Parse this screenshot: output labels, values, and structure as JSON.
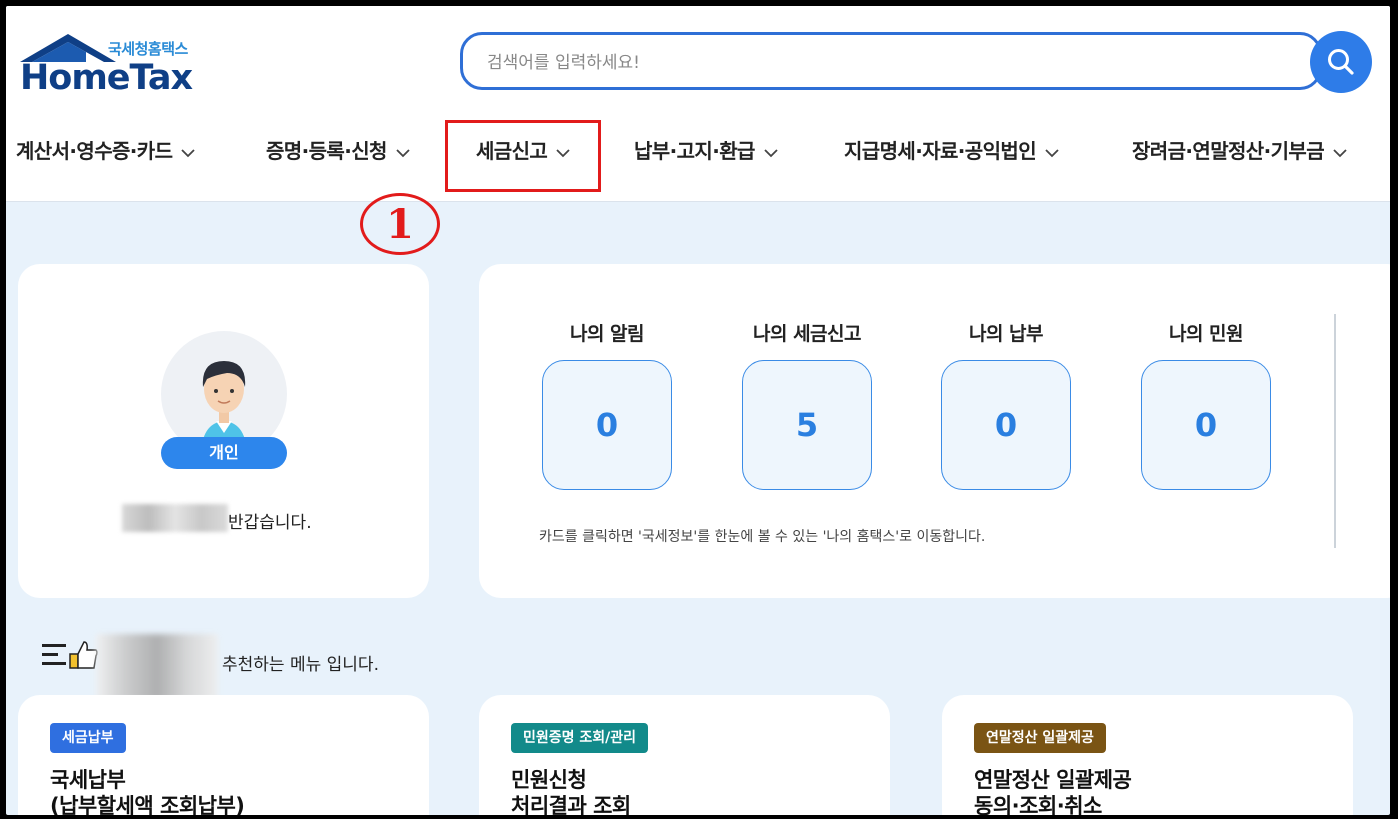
{
  "logo": {
    "subtitle": "국세청홈택스",
    "title": "HomeTax"
  },
  "search": {
    "placeholder": "검색어를 입력하세요!"
  },
  "nav": [
    {
      "label": "계산서·영수증·카드"
    },
    {
      "label": "증명·등록·신청"
    },
    {
      "label": "세금신고"
    },
    {
      "label": "납부·고지·환급"
    },
    {
      "label": "지급명세·자료·공익법인"
    },
    {
      "label": "장려금·연말정산·기부금"
    }
  ],
  "annotation": {
    "step": "1",
    "color": "#e21b1b"
  },
  "profile": {
    "badge": "개인",
    "greeting": "반갑습니다."
  },
  "stats": {
    "items": [
      {
        "title": "나의 알림",
        "value": "0"
      },
      {
        "title": "나의 세금신고",
        "value": "5"
      },
      {
        "title": "나의 납부",
        "value": "0"
      },
      {
        "title": "나의 민원",
        "value": "0"
      }
    ],
    "note": "카드를 클릭하면 '국세정보'를 한눈에 볼 수 있는 '나의 홈택스'로 이동합니다."
  },
  "recommend": {
    "text": "추천하는 메뉴 입니다."
  },
  "cards": [
    {
      "tag": "세금납부",
      "tag_color": "#2f6fe0",
      "line1": "국세납부",
      "line2": "(납부할세액 조회납부)"
    },
    {
      "tag": "민원증명 조회/관리",
      "tag_color": "#128a8a",
      "line1": "민원신청",
      "line2": "처리결과 조회"
    },
    {
      "tag": "연말정산 일괄제공",
      "tag_color": "#7a5414",
      "line1": "연말정산 일괄제공",
      "line2": "동의·조회·취소"
    }
  ],
  "colors": {
    "accent": "#2e7ce8",
    "logo_blue": "#0f3f86",
    "page_bg": "#e8f2fb"
  }
}
